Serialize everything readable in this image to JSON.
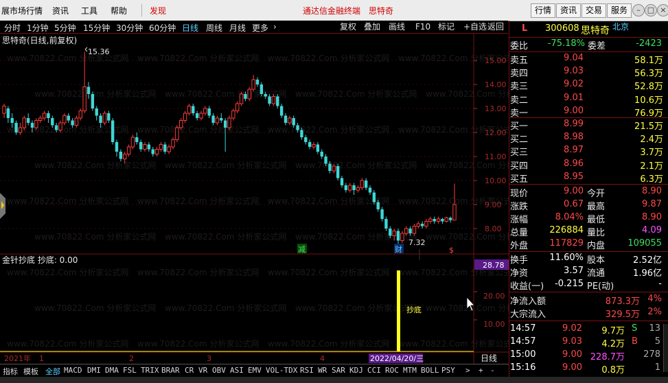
{
  "menu": {
    "items": [
      "展市场行情",
      "资讯",
      "工具",
      "帮助"
    ],
    "discover": "发现",
    "app_title": "通达信金融终端",
    "stock_title": "思特奇",
    "right_buttons": [
      "行情",
      "资讯",
      "交易",
      "服务"
    ]
  },
  "periods": {
    "items": [
      "分时",
      "1分钟",
      "5分钟",
      "15分钟",
      "30分钟",
      "60分钟",
      "日线",
      "周线",
      "月线",
      "更多"
    ],
    "active": "日线",
    "more_arrow": "›",
    "tools": [
      "复权",
      "叠加",
      "画线",
      "F10",
      "标记",
      "+自选",
      "返回"
    ]
  },
  "chart": {
    "title": "思特奇(日线,前复权)",
    "high_label": "15.36",
    "low_label": "7.32",
    "marker_jian": "减",
    "marker_cai": "财",
    "marker_s": "$",
    "y_ticks": [
      "15.00",
      "14.00",
      "13.00",
      "12.00",
      "11.00",
      "10.00",
      "9.00",
      "8.00"
    ],
    "indicator_title": "金针抄底 抄底: 0.00",
    "indicator_value_box": "28.78",
    "indicator_ticks": [
      "20.00",
      "10.00"
    ],
    "chaodi_label": "抄底",
    "date_axis": [
      "2021年",
      "1",
      "2",
      "3",
      "4"
    ],
    "date_cursor": "2022/04/20/三",
    "period_label": "日线"
  },
  "chart_data": {
    "type": "candlestick",
    "ylim": [
      7.2,
      15.6
    ],
    "candles": [
      [
        12.8,
        13.1,
        13.2,
        12.6
      ],
      [
        13.0,
        12.6,
        13.1,
        12.4
      ],
      [
        12.6,
        12.4,
        12.8,
        12.2
      ],
      [
        12.4,
        12.0,
        12.5,
        11.9
      ],
      [
        12.0,
        12.2,
        12.4,
        11.9
      ],
      [
        12.2,
        12.6,
        12.7,
        12.1
      ],
      [
        12.6,
        12.4,
        12.8,
        12.3
      ],
      [
        12.4,
        12.2,
        12.5,
        12.0
      ],
      [
        12.2,
        12.5,
        12.6,
        12.1
      ],
      [
        12.5,
        12.6,
        12.7,
        12.4
      ],
      [
        12.6,
        12.8,
        12.9,
        12.5
      ],
      [
        12.8,
        12.6,
        12.9,
        12.4
      ],
      [
        12.6,
        12.3,
        12.7,
        12.2
      ],
      [
        12.3,
        12.1,
        12.4,
        12.0
      ],
      [
        12.1,
        12.4,
        12.5,
        12.0
      ],
      [
        12.4,
        12.7,
        12.8,
        12.3
      ],
      [
        12.7,
        12.5,
        12.8,
        12.4
      ],
      [
        12.5,
        12.3,
        12.6,
        12.2
      ],
      [
        12.3,
        12.6,
        12.7,
        12.2
      ],
      [
        12.6,
        12.9,
        13.0,
        12.5
      ],
      [
        12.9,
        13.9,
        15.36,
        12.8
      ],
      [
        13.9,
        13.6,
        14.1,
        13.4
      ],
      [
        13.6,
        13.0,
        13.7,
        12.9
      ],
      [
        13.0,
        12.7,
        13.1,
        12.5
      ],
      [
        12.7,
        12.4,
        12.8,
        12.2
      ],
      [
        12.4,
        12.8,
        12.9,
        12.3
      ],
      [
        12.8,
        12.5,
        12.9,
        12.4
      ],
      [
        12.5,
        11.6,
        12.6,
        11.5
      ],
      [
        11.6,
        11.2,
        11.7,
        11.0
      ],
      [
        11.2,
        10.9,
        11.3,
        10.8
      ],
      [
        10.9,
        11.1,
        11.2,
        10.7
      ],
      [
        11.1,
        11.4,
        11.5,
        11.0
      ],
      [
        11.4,
        11.8,
        11.9,
        11.3
      ],
      [
        11.8,
        11.6,
        12.0,
        11.5
      ],
      [
        11.6,
        11.3,
        11.7,
        11.2
      ],
      [
        11.3,
        11.5,
        11.6,
        11.2
      ],
      [
        11.5,
        11.3,
        11.6,
        11.2
      ],
      [
        11.3,
        11.1,
        11.4,
        11.0
      ],
      [
        11.1,
        11.3,
        11.4,
        11.0
      ],
      [
        11.3,
        11.5,
        11.6,
        11.2
      ],
      [
        11.5,
        11.2,
        11.6,
        11.1
      ],
      [
        11.2,
        11.4,
        11.5,
        11.1
      ],
      [
        11.4,
        11.7,
        11.8,
        11.3
      ],
      [
        11.7,
        12.2,
        12.3,
        11.6
      ],
      [
        12.2,
        12.5,
        12.6,
        12.1
      ],
      [
        12.5,
        12.8,
        12.9,
        12.4
      ],
      [
        12.8,
        13.1,
        13.2,
        12.7
      ],
      [
        13.1,
        12.8,
        13.2,
        12.7
      ],
      [
        12.8,
        12.6,
        12.9,
        12.5
      ],
      [
        12.6,
        12.8,
        12.9,
        12.5
      ],
      [
        12.8,
        13.0,
        13.1,
        12.7
      ],
      [
        13.0,
        12.7,
        13.1,
        12.6
      ],
      [
        12.7,
        12.4,
        12.8,
        12.3
      ],
      [
        12.4,
        12.6,
        12.7,
        12.3
      ],
      [
        12.6,
        12.5,
        12.8,
        12.4
      ],
      [
        12.5,
        12.2,
        12.6,
        11.2
      ],
      [
        12.2,
        12.6,
        12.7,
        12.1
      ],
      [
        12.6,
        12.9,
        13.0,
        12.5
      ],
      [
        12.9,
        13.2,
        13.3,
        12.8
      ],
      [
        13.2,
        13.6,
        13.7,
        13.1
      ],
      [
        13.6,
        13.4,
        13.7,
        13.3
      ],
      [
        13.4,
        13.8,
        13.9,
        13.3
      ],
      [
        13.8,
        14.2,
        14.4,
        13.7
      ],
      [
        14.2,
        14.0,
        14.3,
        13.9
      ],
      [
        14.0,
        13.6,
        14.1,
        13.5
      ],
      [
        13.6,
        13.5,
        13.7,
        13.4
      ],
      [
        13.5,
        13.2,
        13.6,
        13.1
      ],
      [
        13.2,
        13.5,
        13.6,
        13.1
      ],
      [
        13.5,
        13.1,
        13.6,
        13.0
      ],
      [
        13.1,
        12.7,
        13.2,
        12.6
      ],
      [
        12.7,
        12.4,
        12.8,
        12.3
      ],
      [
        12.4,
        12.6,
        12.7,
        12.3
      ],
      [
        12.6,
        12.3,
        12.7,
        12.2
      ],
      [
        12.3,
        12.1,
        12.4,
        12.0
      ],
      [
        12.1,
        11.8,
        12.2,
        11.7
      ],
      [
        11.8,
        11.6,
        11.9,
        11.5
      ],
      [
        11.6,
        11.4,
        11.7,
        11.3
      ],
      [
        11.4,
        11.5,
        11.6,
        11.3
      ],
      [
        11.5,
        11.2,
        11.6,
        11.1
      ],
      [
        11.2,
        11.0,
        11.3,
        10.9
      ],
      [
        11.0,
        10.7,
        11.1,
        10.6
      ],
      [
        10.7,
        10.4,
        10.8,
        10.3
      ],
      [
        10.4,
        10.6,
        10.7,
        10.3
      ],
      [
        10.6,
        10.1,
        10.7,
        10.0
      ],
      [
        10.1,
        9.8,
        10.2,
        9.7
      ],
      [
        9.8,
        9.6,
        9.9,
        9.5
      ],
      [
        9.6,
        9.8,
        9.9,
        9.5
      ],
      [
        9.8,
        9.6,
        9.9,
        9.4
      ],
      [
        9.6,
        9.7,
        9.8,
        9.5
      ],
      [
        9.7,
        10.0,
        10.1,
        9.6
      ],
      [
        10.0,
        9.7,
        10.1,
        9.6
      ],
      [
        9.7,
        9.5,
        9.8,
        9.4
      ],
      [
        9.5,
        9.1,
        9.6,
        9.0
      ],
      [
        9.1,
        8.8,
        9.2,
        8.7
      ],
      [
        8.8,
        8.4,
        8.9,
        8.3
      ],
      [
        8.4,
        8.0,
        8.5,
        7.9
      ],
      [
        8.0,
        7.7,
        8.1,
        7.6
      ],
      [
        7.7,
        7.9,
        8.0,
        7.5
      ],
      [
        7.9,
        7.5,
        8.0,
        7.32
      ],
      [
        7.5,
        7.8,
        7.9,
        7.4
      ],
      [
        7.8,
        8.0,
        8.1,
        7.7
      ],
      [
        8.0,
        7.8,
        8.1,
        7.7
      ],
      [
        7.8,
        8.1,
        8.2,
        7.7
      ],
      [
        8.1,
        8.2,
        8.3,
        8.0
      ],
      [
        8.2,
        8.1,
        8.3,
        8.0
      ],
      [
        8.1,
        8.3,
        8.4,
        8.0
      ],
      [
        8.3,
        8.4,
        8.5,
        8.2
      ],
      [
        8.4,
        8.3,
        8.5,
        8.2
      ],
      [
        8.3,
        8.4,
        8.5,
        8.2
      ],
      [
        8.4,
        8.3,
        8.45,
        8.2
      ],
      [
        8.3,
        8.45,
        8.5,
        8.25
      ],
      [
        8.45,
        8.35,
        8.5,
        8.25
      ],
      [
        8.35,
        9.0,
        9.87,
        8.9
      ]
    ],
    "indicator": {
      "name": "抄底",
      "peak_value": 28.78,
      "peak_index": 98
    }
  },
  "quote": {
    "l_badge": "L",
    "code": "300608",
    "name": "思特奇",
    "market": "北京",
    "weibi_label": "委比",
    "weibi": "-75.18%",
    "weicha_label": "委差",
    "weicha": "-2423",
    "sell": [
      {
        "label": "卖五",
        "price": "9.04",
        "vol": "58.1万"
      },
      {
        "label": "卖四",
        "price": "9.03",
        "vol": "56.3万"
      },
      {
        "label": "卖三",
        "price": "9.02",
        "vol": "52.8万"
      },
      {
        "label": "卖二",
        "price": "9.01",
        "vol": "10.6万"
      },
      {
        "label": "卖一",
        "price": "9.00",
        "vol": "76.9万"
      }
    ],
    "buy": [
      {
        "label": "买一",
        "price": "8.99",
        "vol": "21.5万"
      },
      {
        "label": "买二",
        "price": "8.98",
        "vol": "2.4万"
      },
      {
        "label": "买三",
        "price": "8.97",
        "vol": "3.7万"
      },
      {
        "label": "买四",
        "price": "8.96",
        "vol": "2.1万"
      },
      {
        "label": "买五",
        "price": "8.95",
        "vol": "6.3万"
      }
    ],
    "stats": [
      {
        "l1": "现价",
        "v1": "9.00",
        "l2": "今开",
        "v2": "8.90"
      },
      {
        "l1": "涨跌",
        "v1": "0.67",
        "l2": "最高",
        "v2": "9.87"
      },
      {
        "l1": "涨幅",
        "v1": "8.04%",
        "l2": "最低",
        "v2": "8.90"
      },
      {
        "l1": "总量",
        "v1": "226884",
        "l2": "量比",
        "v2": "4.09"
      },
      {
        "l1": "外盘",
        "v1": "117829",
        "l2": "内盘",
        "v2": "109055"
      }
    ],
    "fund": [
      {
        "l1": "换手",
        "v1": "11.60%",
        "l2": "股本",
        "v2": "2.52亿"
      },
      {
        "l1": "净资",
        "v1": "3.57",
        "l2": "流通",
        "v2": "1.96亿"
      },
      {
        "l1": "收益(一)",
        "v1": "-0.215",
        "l2": "PE(动)",
        "v2": "-"
      }
    ],
    "flow": [
      {
        "label": "净流入额",
        "value": "873.3万",
        "pct": "4%"
      },
      {
        "label": "大宗流入",
        "value": "329.5万",
        "pct": "2%"
      }
    ],
    "ticks": [
      {
        "time": "14:57",
        "price": "9.02",
        "vol": "9.7万",
        "flag": "S",
        "num": "13"
      },
      {
        "time": "14:57",
        "price": "9.03",
        "vol": "4.2万",
        "flag": "B",
        "num": "5"
      },
      {
        "time": "15:00",
        "price": "9.00",
        "vol": "228.7万",
        "flag": "",
        "num": "278"
      },
      {
        "time": "15:16",
        "price": "9.00",
        "vol": "0.8万",
        "flag": "",
        "num": "1"
      }
    ]
  },
  "tabs": {
    "left": [
      "指标",
      "模板"
    ],
    "items": [
      "全部",
      "MACD",
      "DMI",
      "DMA",
      "FSL",
      "TRIX",
      "BRAR",
      "CR",
      "VR",
      "OBV",
      "ASI",
      "EMV",
      "VOL-TDX",
      "RSI",
      "WR",
      "SAR",
      "KDJ",
      "CCI",
      "ROC",
      "MTM",
      "BOLL",
      "PSY"
    ],
    "active": "全部",
    "nav": [
      ">",
      "+",
      "-"
    ]
  },
  "watermark": "www.70822.Com 分析家公式网"
}
